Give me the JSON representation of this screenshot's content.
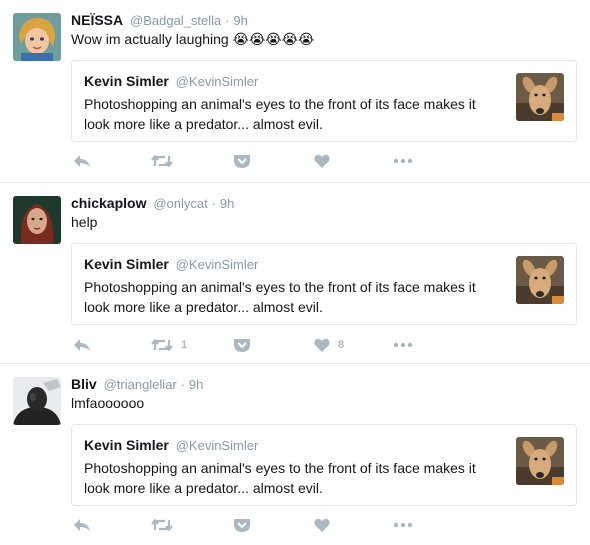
{
  "tweets": [
    {
      "name": "NEÏSSA",
      "handle": "@Badgal_stella",
      "separator": "·",
      "time": "9h",
      "text": "Wow im actually laughing 😭😭😭😭😭",
      "quote": {
        "name": "Kevin Simler",
        "handle": "@KevinSimler",
        "text": "Photoshopping an animal's eyes to the front of its face makes it look more like a predator... almost evil."
      },
      "retweet_count": "",
      "like_count": ""
    },
    {
      "name": "chickaplow",
      "handle": "@onlycat",
      "separator": "·",
      "time": "9h",
      "text": "help",
      "quote": {
        "name": "Kevin Simler",
        "handle": "@KevinSimler",
        "text": "Photoshopping an animal's eyes to the front of its face makes it look more like a predator... almost evil."
      },
      "retweet_count": "1",
      "like_count": "8"
    },
    {
      "name": "Bliv",
      "handle": "@triangleliar",
      "separator": "·",
      "time": "9h",
      "text": "lmfaoooooo",
      "quote": {
        "name": "Kevin Simler",
        "handle": "@KevinSimler",
        "text": "Photoshopping an animal's eyes to the front of its face makes it look more like a predator... almost evil."
      },
      "retweet_count": "",
      "like_count": ""
    }
  ],
  "icons": {
    "reply": "reply-icon",
    "retweet": "retweet-icon",
    "pocket": "pocket-icon",
    "like": "heart-icon",
    "more": "more-icon"
  },
  "colors": {
    "text": "#14171a",
    "muted": "#8899a6",
    "action": "#aab8c2",
    "border": "#e1e8ed"
  }
}
